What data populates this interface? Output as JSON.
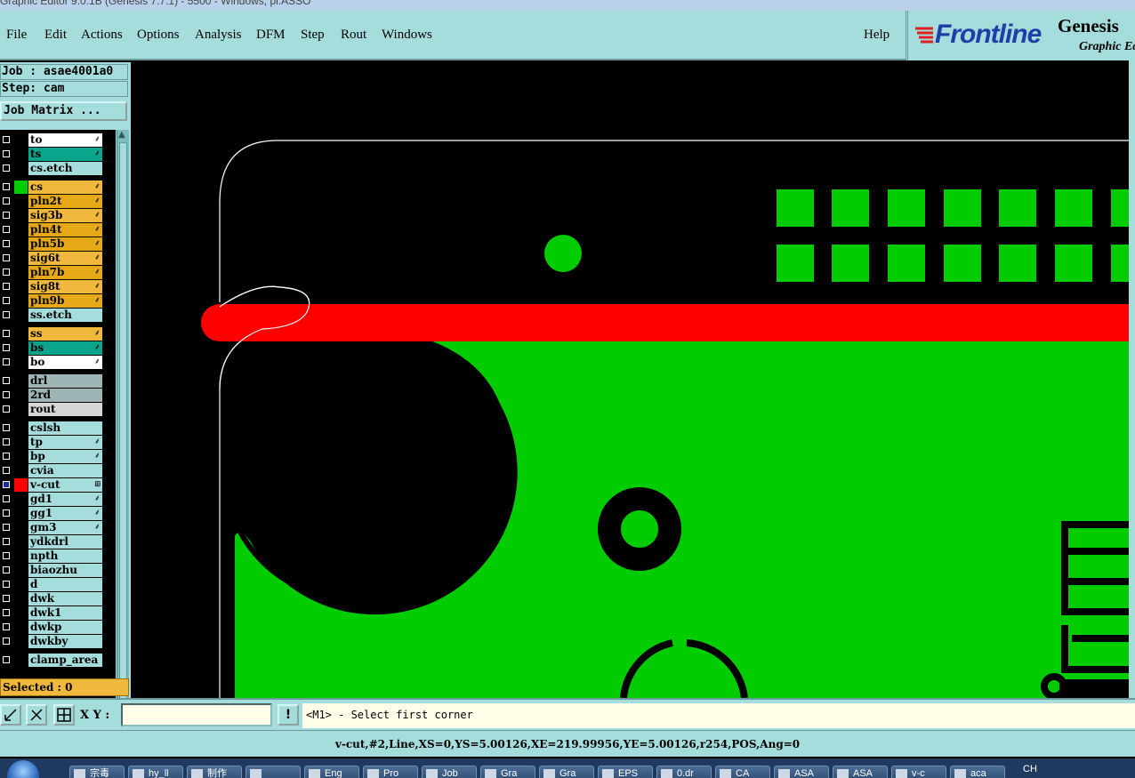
{
  "window": {
    "title": "Graphic Editor 9.0.1B (Genesis 7.7.1) - 5500 - Windows, pl.ASSO"
  },
  "menu": {
    "file": "File",
    "edit": "Edit",
    "actions": "Actions",
    "options": "Options",
    "analysis": "Analysis",
    "dfm": "DFM",
    "step": "Step",
    "rout": "Rout",
    "windows": "Windows",
    "help": "Help"
  },
  "brand": {
    "name": "Frontline",
    "product": "Genesis",
    "subtitle": "Graphic Ed"
  },
  "job": {
    "line": "Job : asae4001a0",
    "step_line": "Step: cam",
    "matrix_button": "Job Matrix ..."
  },
  "layers": [
    {
      "name": "to",
      "color": "#ffffff",
      "flag": "⸙"
    },
    {
      "name": "ts",
      "color": "#0aa58c",
      "flag": "⸙"
    },
    {
      "name": "cs.etch",
      "color": "#a5dcdc",
      "flag": ""
    },
    {
      "name": "cs",
      "color": "#f0b83c",
      "flag": "⸙",
      "swatch": "#00cc00"
    },
    {
      "name": "pln2t",
      "color": "#e6a817",
      "flag": "⸙"
    },
    {
      "name": "sig3b",
      "color": "#f0b83c",
      "flag": "⸙"
    },
    {
      "name": "pln4t",
      "color": "#e6a817",
      "flag": "⸙"
    },
    {
      "name": "pln5b",
      "color": "#e6a817",
      "flag": "⸙"
    },
    {
      "name": "sig6t",
      "color": "#f0b83c",
      "flag": "⸙"
    },
    {
      "name": "pln7b",
      "color": "#e6a817",
      "flag": "⸙"
    },
    {
      "name": "sig8t",
      "color": "#f0b83c",
      "flag": "⸙"
    },
    {
      "name": "pln9b",
      "color": "#e6a817",
      "flag": "⸙"
    },
    {
      "name": "ss.etch",
      "color": "#a5dcdc",
      "flag": ""
    },
    {
      "name": "ss",
      "color": "#f0b83c",
      "flag": "⸙"
    },
    {
      "name": "bs",
      "color": "#0aa58c",
      "flag": "⸙"
    },
    {
      "name": "bo",
      "color": "#ffffff",
      "flag": "⸙"
    },
    {
      "name": "drl",
      "color": "#9fb4b4",
      "flag": ""
    },
    {
      "name": "2rd",
      "color": "#9fb4b4",
      "flag": ""
    },
    {
      "name": "rout",
      "color": "#d6d6d6",
      "flag": ""
    },
    {
      "name": "cslsh",
      "color": "#a5dcdc",
      "flag": ""
    },
    {
      "name": "tp",
      "color": "#a5dcdc",
      "flag": "⸙"
    },
    {
      "name": "bp",
      "color": "#a5dcdc",
      "flag": "⸙"
    },
    {
      "name": "cvia",
      "color": "#a5dcdc",
      "flag": ""
    },
    {
      "name": "v-cut",
      "color": "#a5dcdc",
      "flag": "⊞",
      "swatch": "#ff0000",
      "active": true
    },
    {
      "name": "gd1",
      "color": "#a5dcdc",
      "flag": "⸙"
    },
    {
      "name": "gg1",
      "color": "#a5dcdc",
      "flag": "⸙"
    },
    {
      "name": "gm3",
      "color": "#a5dcdc",
      "flag": "⸙"
    },
    {
      "name": "ydkdrl",
      "color": "#a5dcdc",
      "flag": ""
    },
    {
      "name": "npth",
      "color": "#a5dcdc",
      "flag": ""
    },
    {
      "name": "biaozhu",
      "color": "#a5dcdc",
      "flag": ""
    },
    {
      "name": "d",
      "color": "#a5dcdc",
      "flag": ""
    },
    {
      "name": "dwk",
      "color": "#a5dcdc",
      "flag": ""
    },
    {
      "name": "dwk1",
      "color": "#a5dcdc",
      "flag": ""
    },
    {
      "name": "dwkp",
      "color": "#a5dcdc",
      "flag": ""
    },
    {
      "name": "dwkby",
      "color": "#a5dcdc",
      "flag": ""
    },
    {
      "name": "clamp_area",
      "color": "#a5dcdc",
      "flag": ""
    }
  ],
  "selected": "Selected : 0",
  "input": {
    "xy_label": "X Y :",
    "xy_value": "",
    "excl": "!",
    "prompt": "<M1> - Select first corner"
  },
  "status": "v-cut,#2,Line,XS=0,YS=5.00126,XE=219.99956,YE=5.00126,r254,POS,Ang=0",
  "taskbar": {
    "items": [
      "宗毒",
      "hy_ll",
      "制作",
      "",
      "Eng",
      "Pro",
      "Job",
      "Gra",
      "Gra",
      "EPS",
      "0.dr",
      "CA",
      "ASA",
      "ASA",
      "v-c",
      "aca"
    ],
    "tray": "CH"
  }
}
